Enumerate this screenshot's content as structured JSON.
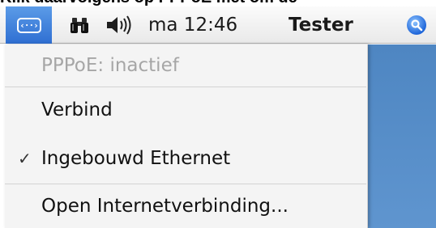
{
  "caption": {
    "text": "Klik daarvolgens op PPPoE met om de"
  },
  "menubar": {
    "network_icon_glyph": "‹··›",
    "clock": "ma 12:46",
    "user": "Tester"
  },
  "menu": {
    "status": "PPPoE: inactief",
    "connect": "Verbind",
    "ethernet_check": "✓",
    "ethernet": "Ingebouwd Ethernet",
    "open_connection": "Open Internetverbinding..."
  },
  "colors": {
    "menubar_highlight": "#3a7bd5",
    "disabled_text": "#a6a6a6",
    "desktop": "#5a8fc9"
  },
  "icons": [
    "network-icon",
    "binoculars-icon",
    "volume-icon",
    "spotlight-icon",
    "checkmark-icon"
  ]
}
